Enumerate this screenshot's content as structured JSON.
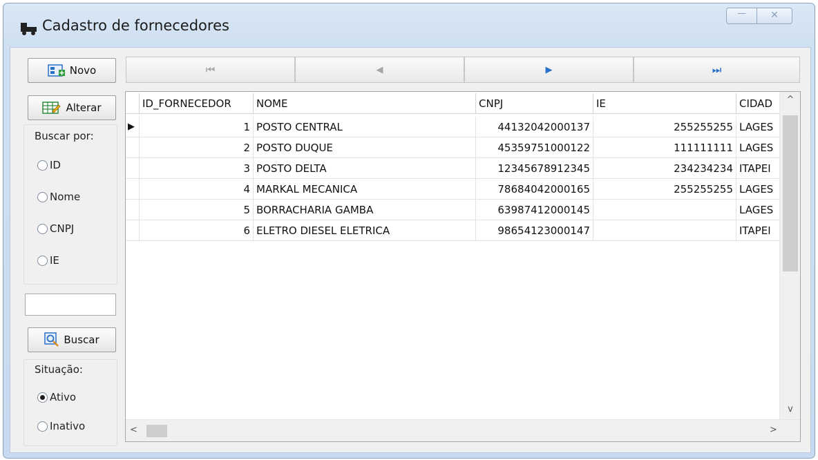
{
  "window": {
    "title": "Cadastro de fornecedores",
    "minimize_glyph": "—",
    "close_glyph": "✕"
  },
  "toolbar": {
    "novo_label": "Novo",
    "alterar_label": "Alterar",
    "buscar_label": "Buscar",
    "nav": [
      {
        "name": "nav-first-button",
        "icon": "first-record-icon",
        "glyph": "⏮"
      },
      {
        "name": "nav-prev-button",
        "icon": "prev-record-icon",
        "glyph": "◀"
      },
      {
        "name": "nav-next-button",
        "icon": "next-record-icon",
        "glyph": "▶"
      },
      {
        "name": "nav-last-button",
        "icon": "last-record-icon",
        "glyph": "⏭"
      }
    ]
  },
  "search": {
    "title": "Buscar por:",
    "options": [
      "ID",
      "Nome",
      "CNPJ",
      "IE"
    ],
    "selected": null,
    "input_value": ""
  },
  "situacao": {
    "title": "Situação:",
    "options": [
      "Ativo",
      "Inativo"
    ],
    "selected": "Ativo"
  },
  "grid": {
    "columns": [
      "ID_FORNECEDOR",
      "NOME",
      "CNPJ",
      "IE",
      "CIDAD"
    ],
    "rows": [
      [
        "1",
        "POSTO CENTRAL",
        "44132042000137",
        "255255255",
        "LAGES"
      ],
      [
        "2",
        "POSTO DUQUE",
        "45359751000122",
        "111111111",
        "LAGES"
      ],
      [
        "3",
        "POSTO DELTA",
        "12345678912345",
        "234234234",
        "ITAPEI"
      ],
      [
        "4",
        "MARKAL MECANICA",
        "78684042000165",
        "255255255",
        "LAGES"
      ],
      [
        "5",
        "BORRACHARIA GAMBA",
        "63987412000145",
        "",
        "LAGES"
      ],
      [
        "6",
        "ELETRO DIESEL ELETRICA",
        "98654123000147",
        "",
        "ITAPEI"
      ]
    ],
    "current_row_marker": "▶",
    "scroll_up": "^",
    "scroll_down": "v",
    "scroll_left": "<",
    "scroll_right": ">"
  },
  "colors": {
    "accent_blue": "#2a6fc9",
    "frame": "#c7daef"
  }
}
